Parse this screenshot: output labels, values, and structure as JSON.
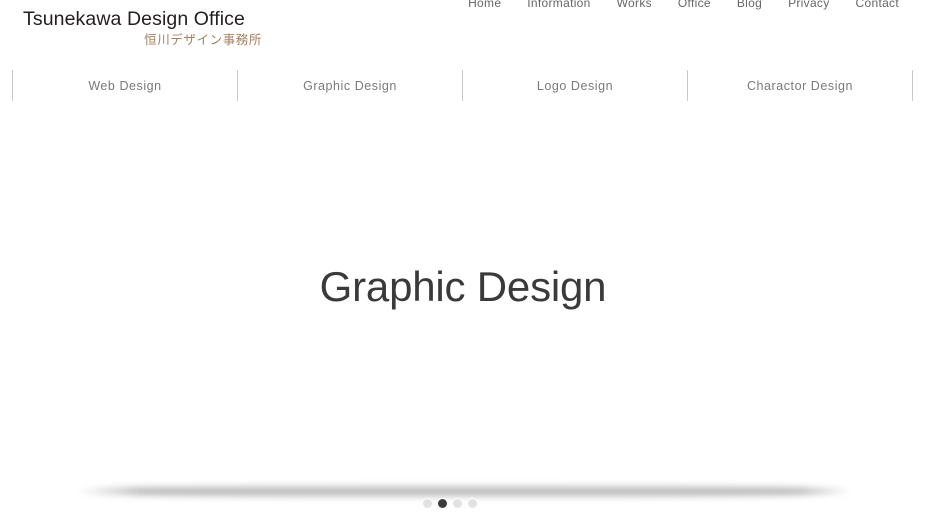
{
  "brand": {
    "title": "Tsunekawa Design Office",
    "subtitle": "恒川デザイン事務所",
    "subtitle_color": "#a5805d",
    "title_color": "#231f20"
  },
  "top_nav": {
    "items": [
      {
        "label": "Home"
      },
      {
        "label": "Information"
      },
      {
        "label": "Works"
      },
      {
        "label": "Office"
      },
      {
        "label": "Blog"
      },
      {
        "label": "Privacy"
      },
      {
        "label": "Contact"
      }
    ]
  },
  "category_nav": {
    "items": [
      {
        "label": "Web Design"
      },
      {
        "label": "Graphic Design"
      },
      {
        "label": "Logo Design"
      },
      {
        "label": "Charactor Design"
      }
    ],
    "text_color": "#7a7a7a",
    "divider_color": "#c9c9cd"
  },
  "hero": {
    "title": "Graphic Design",
    "title_color": "#3a3a3a"
  },
  "slider": {
    "total_slides": 4,
    "active_index": 1,
    "dot_color": "#e2e2e2",
    "dot_active_color": "#3b3b3b"
  }
}
